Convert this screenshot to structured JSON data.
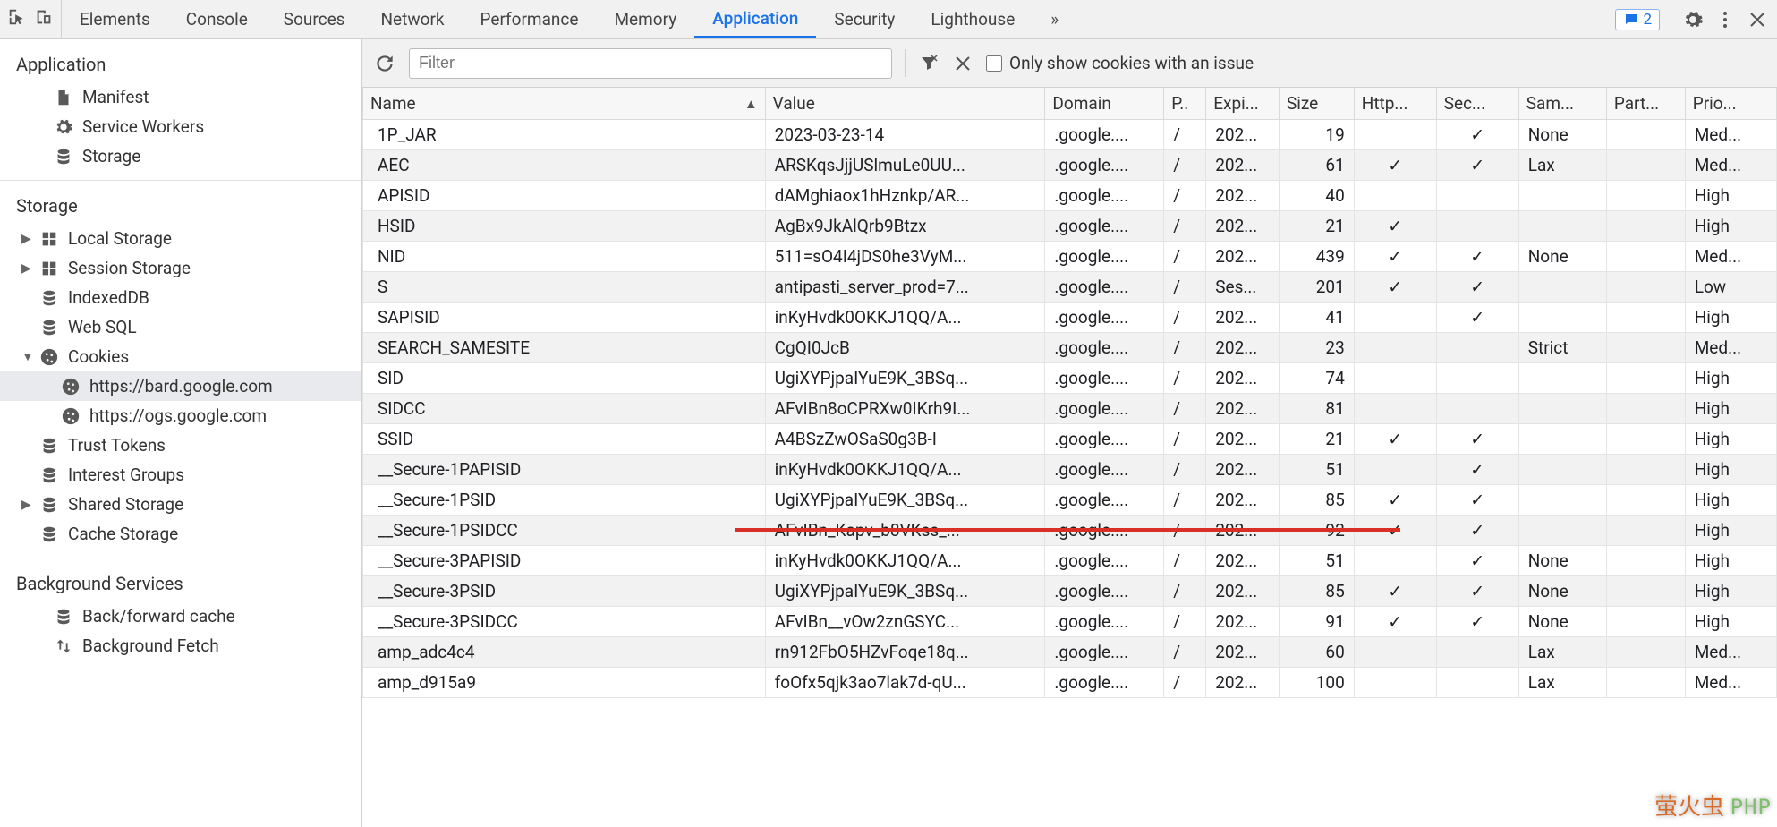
{
  "tabs": {
    "list": [
      "Elements",
      "Console",
      "Sources",
      "Network",
      "Performance",
      "Memory",
      "Application",
      "Security",
      "Lighthouse"
    ],
    "active": "Application",
    "more_indicator": "»",
    "message_count": "2"
  },
  "sidebar": {
    "section_app": "Application",
    "app_items": [
      {
        "icon": "doc",
        "label": "Manifest"
      },
      {
        "icon": "gear",
        "label": "Service Workers"
      },
      {
        "icon": "db",
        "label": "Storage"
      }
    ],
    "section_storage": "Storage",
    "storage_items": [
      {
        "caret": "▶",
        "icon": "grid",
        "label": "Local Storage"
      },
      {
        "caret": "▶",
        "icon": "grid",
        "label": "Session Storage"
      },
      {
        "caret": "",
        "icon": "db",
        "label": "IndexedDB"
      },
      {
        "caret": "",
        "icon": "db",
        "label": "Web SQL"
      },
      {
        "caret": "▼",
        "icon": "cookie",
        "label": "Cookies",
        "expanded": true
      },
      {
        "caret": "",
        "icon": "db",
        "label": "Trust Tokens"
      },
      {
        "caret": "",
        "icon": "db",
        "label": "Interest Groups"
      },
      {
        "caret": "▶",
        "icon": "db",
        "label": "Shared Storage"
      },
      {
        "caret": "",
        "icon": "db",
        "label": "Cache Storage"
      }
    ],
    "cookie_entries": [
      {
        "url": "https://bard.google.com",
        "selected": true
      },
      {
        "url": "https://ogs.google.com",
        "selected": false
      }
    ],
    "section_bg": "Background Services",
    "bg_items": [
      {
        "icon": "db",
        "label": "Back/forward cache"
      },
      {
        "icon": "updown",
        "label": "Background Fetch"
      }
    ]
  },
  "toolbar": {
    "filter_placeholder": "Filter",
    "only_issue_label": "Only show cookies with an issue"
  },
  "table": {
    "headers": [
      "Name",
      "Value",
      "Domain",
      "P..",
      "Expi...",
      "Size",
      "Http...",
      "Sec...",
      "Sam...",
      "Part...",
      "Prio..."
    ],
    "rows": [
      {
        "name": "1P_JAR",
        "value": "2023-03-23-14",
        "domain": ".google....",
        "path": "/",
        "exp": "202...",
        "size": "19",
        "http": "",
        "sec": "✓",
        "same": "None",
        "part": "",
        "prio": "Med..."
      },
      {
        "name": "AEC",
        "value": "ARSKqsJjjUSlmuLe0UU...",
        "domain": ".google....",
        "path": "/",
        "exp": "202...",
        "size": "61",
        "http": "✓",
        "sec": "✓",
        "same": "Lax",
        "part": "",
        "prio": "Med..."
      },
      {
        "name": "APISID",
        "value": "dAMghiaox1hHznkp/AR...",
        "domain": ".google....",
        "path": "/",
        "exp": "202...",
        "size": "40",
        "http": "",
        "sec": "",
        "same": "",
        "part": "",
        "prio": "High"
      },
      {
        "name": "HSID",
        "value": "AgBx9JkAlQrb9Btzx",
        "domain": ".google....",
        "path": "/",
        "exp": "202...",
        "size": "21",
        "http": "✓",
        "sec": "",
        "same": "",
        "part": "",
        "prio": "High"
      },
      {
        "name": "NID",
        "value": "511=sO4I4jDS0he3VyM...",
        "domain": ".google....",
        "path": "/",
        "exp": "202...",
        "size": "439",
        "http": "✓",
        "sec": "✓",
        "same": "None",
        "part": "",
        "prio": "Med..."
      },
      {
        "name": "S",
        "value": "antipasti_server_prod=7...",
        "domain": ".google....",
        "path": "/",
        "exp": "Ses...",
        "size": "201",
        "http": "✓",
        "sec": "✓",
        "same": "",
        "part": "",
        "prio": "Low"
      },
      {
        "name": "SAPISID",
        "value": "inKyHvdk0OKKJ1QQ/A...",
        "domain": ".google....",
        "path": "/",
        "exp": "202...",
        "size": "41",
        "http": "",
        "sec": "✓",
        "same": "",
        "part": "",
        "prio": "High"
      },
      {
        "name": "SEARCH_SAMESITE",
        "value": "CgQI0JcB",
        "domain": ".google....",
        "path": "/",
        "exp": "202...",
        "size": "23",
        "http": "",
        "sec": "",
        "same": "Strict",
        "part": "",
        "prio": "Med..."
      },
      {
        "name": "SID",
        "value": "UgiXYPjpaIYuE9K_3BSq...",
        "domain": ".google....",
        "path": "/",
        "exp": "202...",
        "size": "74",
        "http": "",
        "sec": "",
        "same": "",
        "part": "",
        "prio": "High"
      },
      {
        "name": "SIDCC",
        "value": "AFvIBn8oCPRXw0IKrh9I...",
        "domain": ".google....",
        "path": "/",
        "exp": "202...",
        "size": "81",
        "http": "",
        "sec": "",
        "same": "",
        "part": "",
        "prio": "High"
      },
      {
        "name": "SSID",
        "value": "A4BSzZwOSaS0g3B-I",
        "domain": ".google....",
        "path": "/",
        "exp": "202...",
        "size": "21",
        "http": "✓",
        "sec": "✓",
        "same": "",
        "part": "",
        "prio": "High"
      },
      {
        "name": "__Secure-1PAPISID",
        "value": "inKyHvdk0OKKJ1QQ/A...",
        "domain": ".google....",
        "path": "/",
        "exp": "202...",
        "size": "51",
        "http": "",
        "sec": "✓",
        "same": "",
        "part": "",
        "prio": "High"
      },
      {
        "name": "__Secure-1PSID",
        "value": "UgiXYPjpaIYuE9K_3BSq...",
        "domain": ".google....",
        "path": "/",
        "exp": "202...",
        "size": "85",
        "http": "✓",
        "sec": "✓",
        "same": "",
        "part": "",
        "prio": "High"
      },
      {
        "name": "__Secure-1PSIDCC",
        "value": "AFvIBn_Kapv_b8VKss_...",
        "domain": ".google....",
        "path": "/",
        "exp": "202...",
        "size": "92",
        "http": "✓",
        "sec": "✓",
        "same": "",
        "part": "",
        "prio": "High"
      },
      {
        "name": "__Secure-3PAPISID",
        "value": "inKyHvdk0OKKJ1QQ/A...",
        "domain": ".google....",
        "path": "/",
        "exp": "202...",
        "size": "51",
        "http": "",
        "sec": "✓",
        "same": "None",
        "part": "",
        "prio": "High"
      },
      {
        "name": "__Secure-3PSID",
        "value": "UgiXYPjpaIYuE9K_3BSq...",
        "domain": ".google....",
        "path": "/",
        "exp": "202...",
        "size": "85",
        "http": "✓",
        "sec": "✓",
        "same": "None",
        "part": "",
        "prio": "High"
      },
      {
        "name": "__Secure-3PSIDCC",
        "value": "AFvIBn__vOw2znGSYC...",
        "domain": ".google....",
        "path": "/",
        "exp": "202...",
        "size": "91",
        "http": "✓",
        "sec": "✓",
        "same": "None",
        "part": "",
        "prio": "High"
      },
      {
        "name": "amp_adc4c4",
        "value": "rn912FbO5HZvFoqe18q...",
        "domain": ".google....",
        "path": "/",
        "exp": "202...",
        "size": "60",
        "http": "",
        "sec": "",
        "same": "Lax",
        "part": "",
        "prio": "Med..."
      },
      {
        "name": "amp_d915a9",
        "value": "foOfx5qjk3ao7lak7d-qU...",
        "domain": ".google....",
        "path": "/",
        "exp": "202...",
        "size": "100",
        "http": "",
        "sec": "",
        "same": "Lax",
        "part": "",
        "prio": "Med..."
      }
    ]
  },
  "watermark": {
    "text": "萤火虫",
    "suffix": "PHP"
  }
}
